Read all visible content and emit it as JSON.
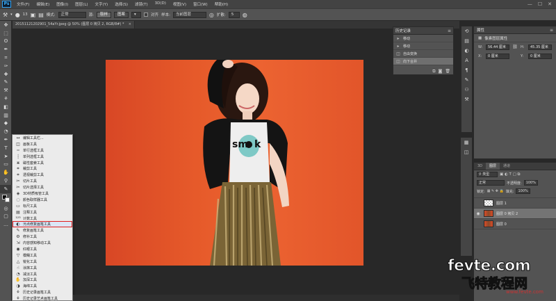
{
  "app": {
    "logo": "Ps",
    "window_controls": [
      "—",
      "☐",
      "✕"
    ]
  },
  "menu": [
    "文件(F)",
    "编辑(E)",
    "图像(I)",
    "图层(L)",
    "文字(Y)",
    "选择(S)",
    "滤镜(T)",
    "3D(D)",
    "视图(V)",
    "窗口(W)",
    "帮助(H)"
  ],
  "options": {
    "brush_size": "13",
    "mode_label": "模式:",
    "mode_value": "正常",
    "source_label": "源:",
    "source_sampled": "取样",
    "source_pattern": "图案",
    "aligned_label": "对齐",
    "sample_label": "样本:",
    "sample_value": "当前图层",
    "diffusion_label": "扩散:",
    "diffusion_value": "5"
  },
  "document": {
    "tab_title": "20151121202901_54aYr.jpeg @ 50% (图层 0 拷贝 2, RGB/8#) *",
    "close": "×"
  },
  "tools": [
    "move",
    "marquee",
    "lasso",
    "quick-select",
    "crop",
    "eyedropper",
    "healing",
    "brush",
    "stamp",
    "history-brush",
    "eraser",
    "gradient",
    "blur",
    "dodge",
    "pen",
    "type",
    "path-select",
    "shape",
    "hand",
    "zoom",
    "healing-selected",
    "swatches",
    "quickmask",
    "screenmode",
    "extra"
  ],
  "flyout": {
    "selected_index": 14,
    "items": [
      {
        "icon": "↔",
        "label": "编辑工具栏..."
      },
      {
        "icon": "◫",
        "label": "画板工具"
      },
      {
        "icon": "┅",
        "label": "单行选框工具"
      },
      {
        "icon": "┆",
        "label": "单列选框工具"
      },
      {
        "icon": "⋇",
        "label": "磁性套索工具"
      },
      {
        "icon": "⌗",
        "label": "裁剪工具"
      },
      {
        "icon": "⌗",
        "label": "透视裁剪工具"
      },
      {
        "icon": "✂",
        "label": "切片工具"
      },
      {
        "icon": "✂",
        "label": "切片选择工具"
      },
      {
        "icon": "◈",
        "label": "3D材质吸管工具"
      },
      {
        "icon": "◌",
        "label": "颜色取样器工具"
      },
      {
        "icon": "▭",
        "label": "标尺工具"
      },
      {
        "icon": "▤",
        "label": "注释工具"
      },
      {
        "icon": "¹²³",
        "label": "计数工具"
      },
      {
        "icon": "◐",
        "label": "污点修复画笔工具"
      },
      {
        "icon": "✎",
        "label": "修复画笔工具"
      },
      {
        "icon": "⚙",
        "label": "修补工具"
      },
      {
        "icon": "⇲",
        "label": "内容感知移动工具"
      },
      {
        "icon": "◉",
        "label": "红眼工具"
      },
      {
        "icon": "▽",
        "label": "模糊工具"
      },
      {
        "icon": "△",
        "label": "锐化工具"
      },
      {
        "icon": "☝",
        "label": "涂抹工具"
      },
      {
        "icon": "◔",
        "label": "减淡工具"
      },
      {
        "icon": "✋",
        "label": "加深工具"
      },
      {
        "icon": "◑",
        "label": "海绵工具"
      },
      {
        "icon": "⚘",
        "label": "历史记录画笔工具"
      },
      {
        "icon": "⚘",
        "label": "历史记录艺术画笔工具"
      }
    ]
  },
  "history": {
    "title": "历史记录",
    "items": [
      {
        "icon": "▸",
        "label": "移动"
      },
      {
        "icon": "▸",
        "label": "移动"
      },
      {
        "icon": "◫",
        "label": "自由变换"
      },
      {
        "icon": "◫",
        "label": "向下合并"
      }
    ],
    "active_index": 3
  },
  "properties": {
    "title": "属性",
    "subtitle": "像素图层属性",
    "w_label": "W:",
    "w_value": "56.44 厘米",
    "h_label": "H:",
    "h_value": "45.35 厘米",
    "x_label": "X:",
    "x_value": "0 厘米",
    "y_label": "Y:",
    "y_value": "0 厘米"
  },
  "layers": {
    "tabs": [
      "3D",
      "图层",
      "通道"
    ],
    "active_tab": 1,
    "filter": "类型",
    "blend": "正常",
    "opacity_label": "不透明度:",
    "opacity_value": "100%",
    "lock_label": "锁定:",
    "fill_label": "填充:",
    "fill_value": "100%",
    "items": [
      {
        "name": "图层 1",
        "thumb": "blank",
        "visible": false
      },
      {
        "name": "图层 0 拷贝 2",
        "thumb": "photo",
        "visible": true
      },
      {
        "name": "图层 0",
        "thumb": "photo",
        "visible": false
      }
    ],
    "active_index": 1
  },
  "watermark": {
    "main": "fevte.com",
    "sub": "飞特教程网",
    "url": "www.fevte.com"
  }
}
